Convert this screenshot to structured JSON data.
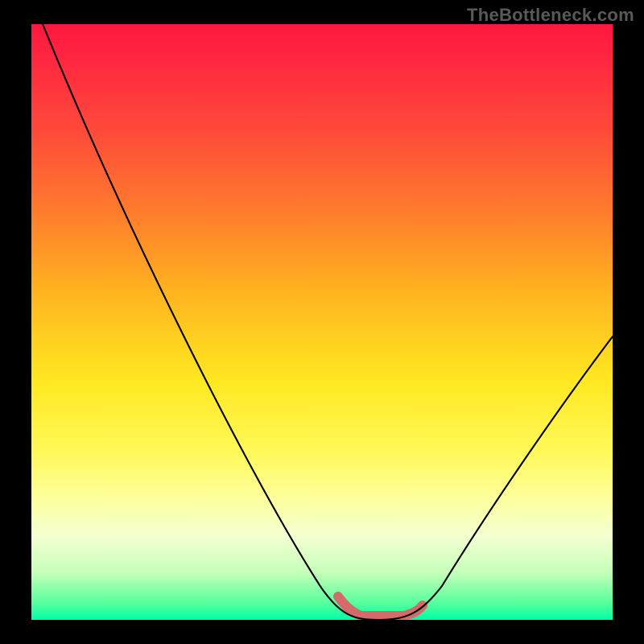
{
  "watermark": "TheBottleneck.com",
  "colors": {
    "background": "#000000",
    "gradient_top": "#ff173f",
    "gradient_bottom": "#00ffa6",
    "curve_stroke": "#000000",
    "highlight_stroke": "#d46a6a",
    "watermark_text": "#595959"
  },
  "chart_data": {
    "type": "line",
    "title": "",
    "xlabel": "",
    "ylabel": "",
    "xlim": [
      0,
      100
    ],
    "ylim": [
      0,
      100
    ],
    "grid": false,
    "legend": false,
    "background": "heat-gradient",
    "series": [
      {
        "name": "bottleneck-curve",
        "x": [
          2,
          10,
          20,
          30,
          40,
          48,
          53,
          56,
          60,
          64,
          68,
          75,
          85,
          95,
          100
        ],
        "y": [
          100,
          84,
          65,
          46,
          28,
          12,
          4,
          1,
          0,
          0,
          2,
          10,
          26,
          44,
          53
        ]
      }
    ],
    "highlight_region": {
      "name": "flat-minimum",
      "x": [
        53,
        56,
        60,
        64,
        67
      ],
      "y": [
        4,
        1,
        0,
        0,
        1
      ]
    }
  }
}
